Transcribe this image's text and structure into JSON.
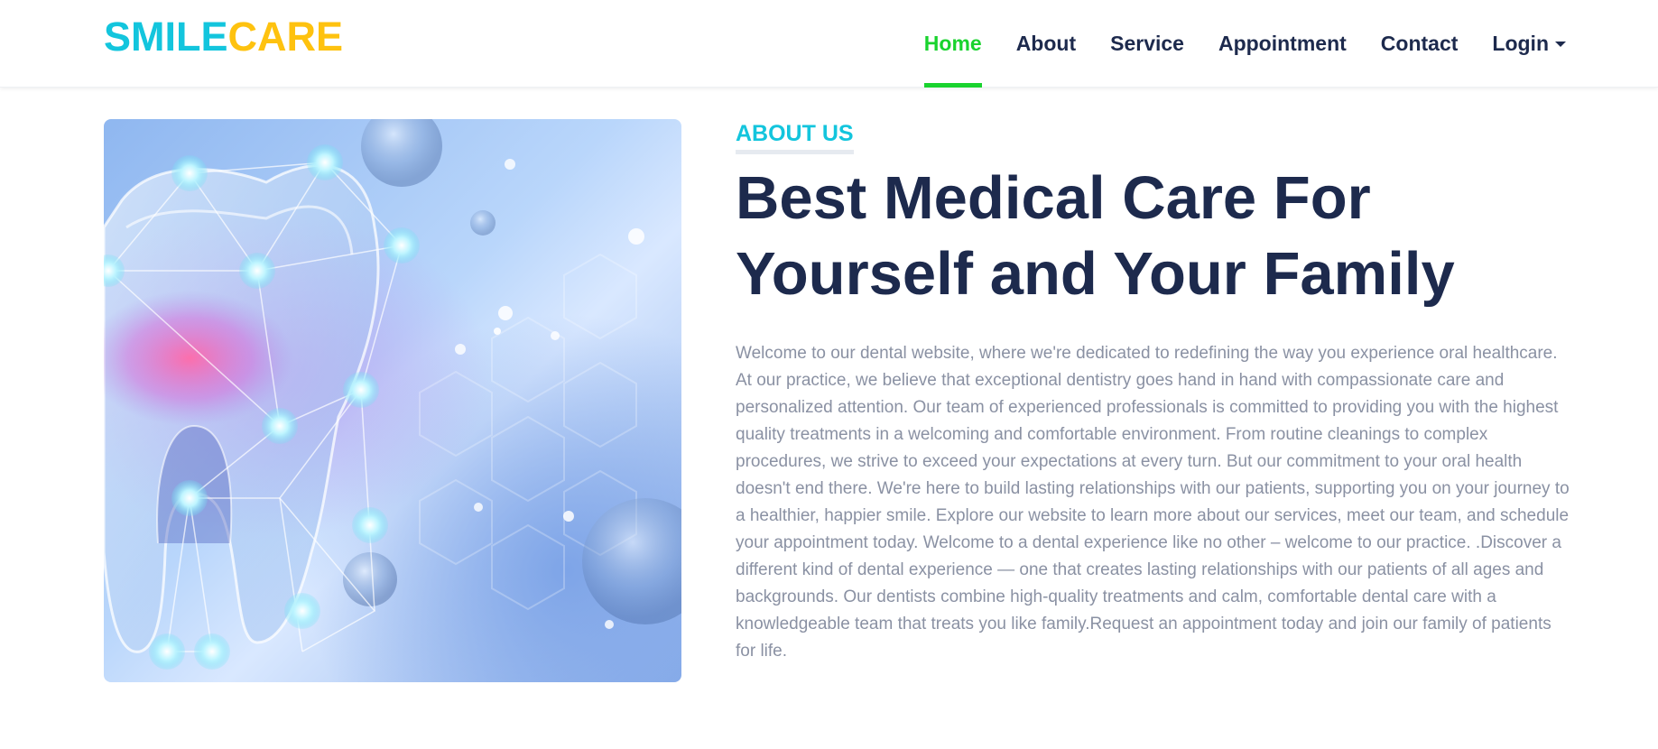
{
  "brand": {
    "part1": "SMILE",
    "part2": "CARE"
  },
  "nav": {
    "items": [
      {
        "label": "Home",
        "active": true
      },
      {
        "label": "About"
      },
      {
        "label": "Service"
      },
      {
        "label": "Appointment"
      },
      {
        "label": "Contact"
      },
      {
        "label": "Login",
        "dropdown": true
      }
    ]
  },
  "about": {
    "subtitle": "ABOUT US",
    "headline": "Best Medical Care For Yourself and Your Family",
    "body": "Welcome to our dental website, where we're dedicated to redefining the way you experience oral healthcare. At our practice, we believe that exceptional dentistry goes hand in hand with compassionate care and personalized attention. Our team of experienced professionals is committed to providing you with the highest quality treatments in a welcoming and comfortable environment. From routine cleanings to complex procedures, we strive to exceed your expectations at every turn. But our commitment to your oral health doesn't end there. We're here to build lasting relationships with our patients, supporting you on your journey to a healthier, happier smile. Explore our website to learn more about our services, meet our team, and schedule your appointment today. Welcome to a dental experience like no other – welcome to our practice. .Discover a different kind of dental experience — one that creates lasting relationships with our patients of all ages and backgrounds. Our dentists combine high-quality treatments and calm, comfortable dental care with a knowledgeable team that treats you like family.Request an appointment today and join our family of patients for life."
  },
  "colors": {
    "brand_cyan": "#13c5dd",
    "brand_yellow": "#fec20f",
    "nav_active": "#19d32e",
    "heading": "#1d2a4d",
    "body_text": "#8a91a3"
  },
  "icons": {
    "login_caret": "caret-down-icon"
  }
}
